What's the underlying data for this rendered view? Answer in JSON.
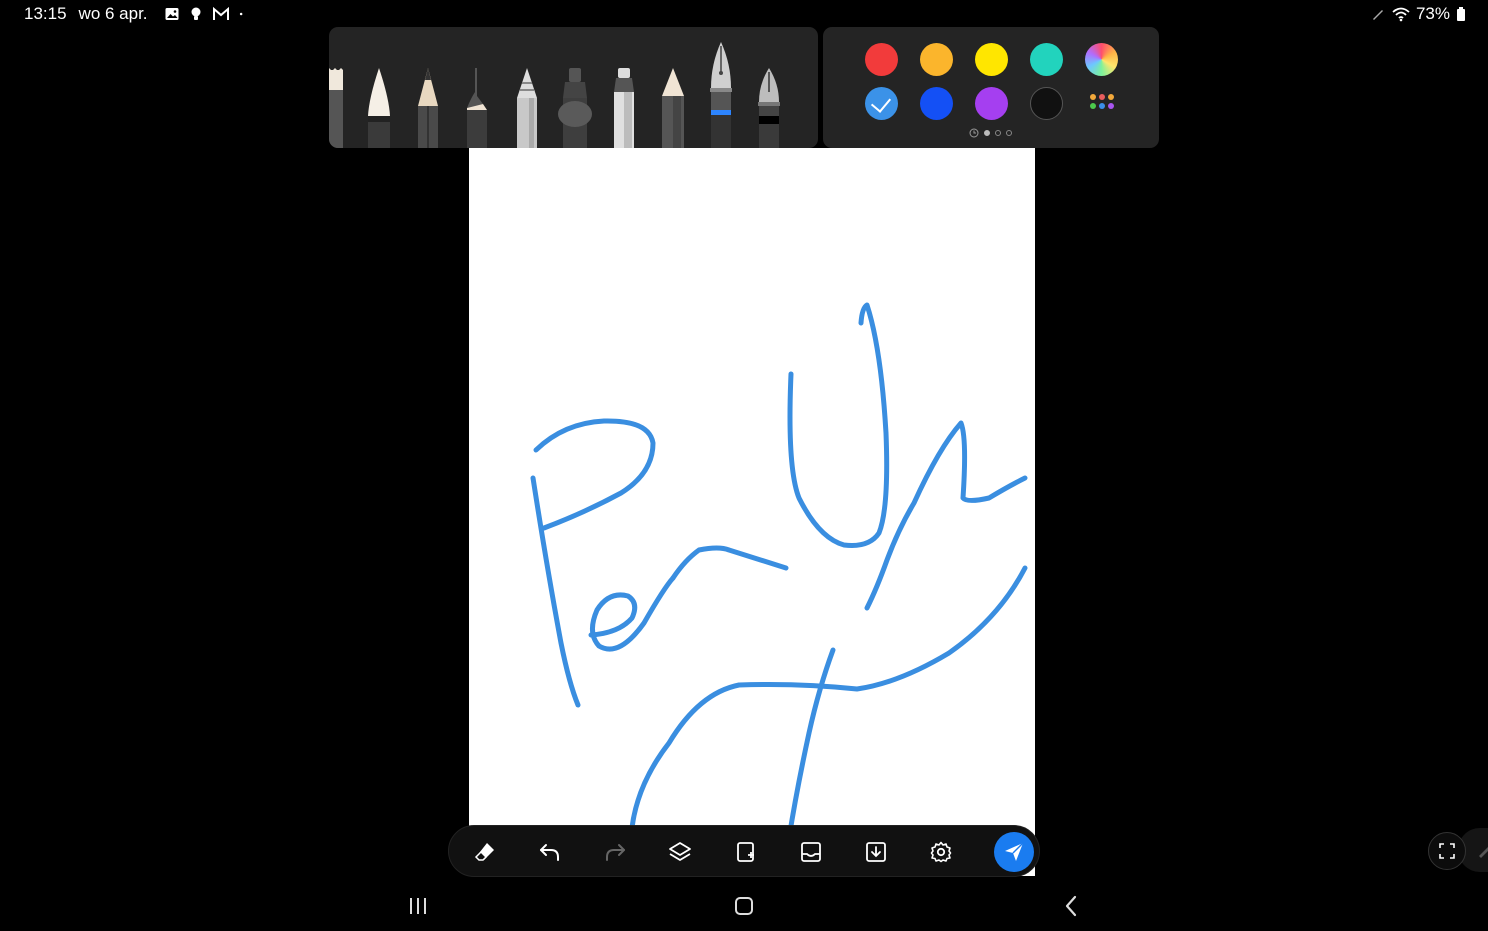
{
  "status_bar": {
    "time": "13:15",
    "date": "wo 6 apr.",
    "notification_icons": [
      "image-icon",
      "bulb-icon",
      "gmail-icon",
      "more-dot-icon"
    ],
    "right_icons": [
      "pen-icon",
      "wifi-icon",
      "battery-icon"
    ],
    "battery": "73%"
  },
  "pen_tray": {
    "pens": [
      {
        "name": "brush-pen",
        "color": "#f0e8dc"
      },
      {
        "name": "calligraphy-brush",
        "color": "#f5efe6"
      },
      {
        "name": "pencil-dark",
        "color": "#444"
      },
      {
        "name": "calligraphy-pen",
        "color": "#333"
      },
      {
        "name": "crayon",
        "color": "#ccc"
      },
      {
        "name": "marker-round",
        "color": "#555"
      },
      {
        "name": "highlighter",
        "color": "#ddd"
      },
      {
        "name": "charcoal",
        "color": "#f0e4d4"
      },
      {
        "name": "fountain-pen-silver",
        "color": "#2d85ff"
      },
      {
        "name": "fountain-pen-dark",
        "color": "#222"
      }
    ]
  },
  "palette": {
    "colors": [
      {
        "name": "red",
        "hex": "#f23b3b"
      },
      {
        "name": "orange",
        "hex": "#fbb52c"
      },
      {
        "name": "yellow",
        "hex": "#ffe600"
      },
      {
        "name": "teal",
        "hex": "#22d3bd"
      },
      {
        "name": "spectrum",
        "hex": "gradient"
      },
      {
        "name": "light-blue",
        "hex": "#3b92e8",
        "selected": true
      },
      {
        "name": "blue",
        "hex": "#1450f5"
      },
      {
        "name": "purple",
        "hex": "#a53ff0"
      },
      {
        "name": "black",
        "hex": "#111111"
      },
      {
        "name": "more-colors",
        "hex": "multi"
      }
    ],
    "pages": 4,
    "active_page": 2
  },
  "canvas": {
    "stroke_color": "#3a8ee0",
    "background": "#ffffff"
  },
  "toolbar": {
    "tools": [
      "eraser-icon",
      "undo-icon",
      "redo-icon",
      "layers-icon",
      "add-page-icon",
      "import-image-icon",
      "download-icon",
      "settings-icon"
    ],
    "send": "send-icon"
  },
  "nav_bar": {
    "buttons": [
      "recent-apps-icon",
      "home-icon",
      "back-icon"
    ]
  }
}
